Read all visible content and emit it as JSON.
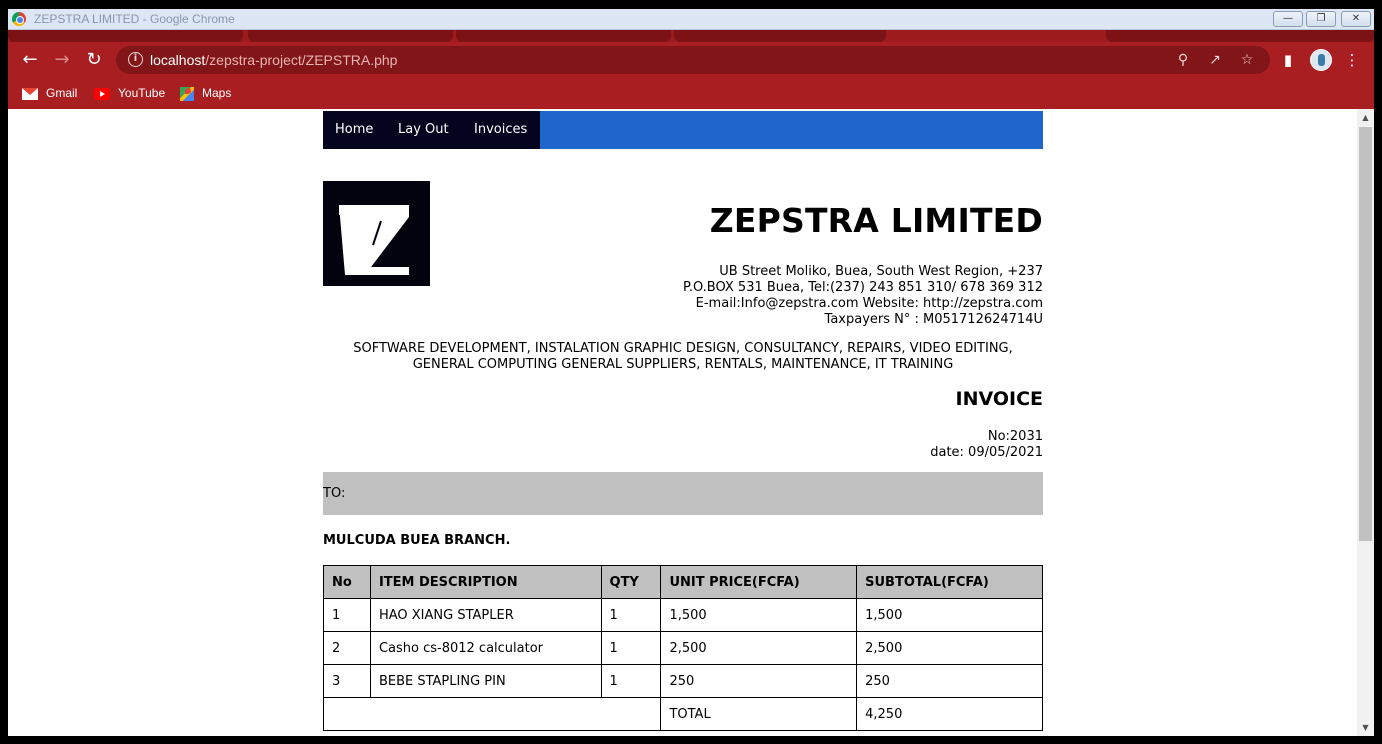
{
  "browser": {
    "window_title": "ZEPSTRA LIMITED - Google Chrome",
    "url_host": "localhost",
    "url_path": "/zepstra-project/ZEPSTRA.php",
    "bookmarks": [
      {
        "label": "Gmail",
        "icon": "gmail-icon"
      },
      {
        "label": "YouTube",
        "icon": "youtube-icon"
      },
      {
        "label": "Maps",
        "icon": "maps-icon"
      }
    ],
    "colors": {
      "frame": "#a91e21",
      "omnibox": "#821517"
    }
  },
  "nav": {
    "items": [
      "Home",
      "Lay Out",
      "Invoices"
    ],
    "bg_color": "#04041f",
    "bar_color": "#1e66cc"
  },
  "header": {
    "company_name": "ZEPSTRA LIMITED",
    "address_lines": [
      "UB Street Moliko, Buea, South West Region, +237",
      "P.O.BOX 531 Buea, Tel:(237) 243 851 310/ 678 369 312",
      "E-mail:Info@zepstra.com Website: http://zepstra.com",
      "Taxpayers N° : M051712624714U"
    ],
    "services_lines": [
      "SOFTWARE DEVELOPMENT, INSTALATION GRAPHIC DESIGN, CONSULTANCY, REPAIRS, VIDEO EDITING,",
      "GENERAL COMPUTING GENERAL SUPPLIERS, RENTALS, MAINTENANCE, IT TRAINING"
    ]
  },
  "invoice": {
    "title": "INVOICE",
    "number_line": "No:2031",
    "date_line": "date: 09/05/2021",
    "to_label": "TO:",
    "client": "MULCUDA BUEA BRANCH.",
    "columns": [
      "No",
      "ITEM DESCRIPTION",
      "QTY",
      "UNIT PRICE(FCFA)",
      "SUBTOTAL(FCFA)"
    ],
    "rows": [
      [
        "1",
        "HAO XIANG STAPLER",
        "1",
        "1,500",
        "1,500"
      ],
      [
        "2",
        "Casho cs-8012 calculator",
        "1",
        "2,500",
        "2,500"
      ],
      [
        "3",
        "BEBE STAPLING PIN",
        "1",
        "250",
        "250"
      ]
    ],
    "total_label": "TOTAL",
    "total_value": "4,250"
  }
}
